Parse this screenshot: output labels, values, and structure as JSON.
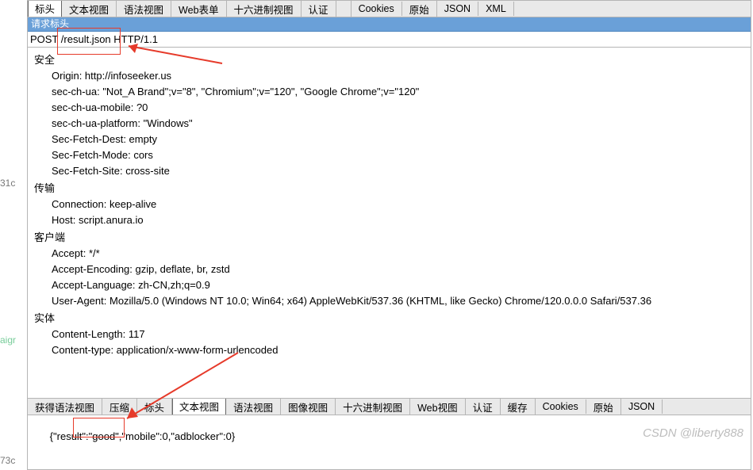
{
  "gutter": {
    "g1": "31c",
    "g2": "aigr",
    "g3": "73c"
  },
  "top_tabs": [
    {
      "id": "headers",
      "label": "标头",
      "selected": true
    },
    {
      "id": "textview",
      "label": "文本视图"
    },
    {
      "id": "syntaxview",
      "label": "语法视图"
    },
    {
      "id": "webforms",
      "label": "Web表单"
    },
    {
      "id": "hexview",
      "label": "十六进制视图"
    },
    {
      "id": "auth",
      "label": "认证"
    },
    {
      "id": "cookies",
      "label": "Cookies"
    },
    {
      "id": "raw",
      "label": "原始"
    },
    {
      "id": "json",
      "label": "JSON"
    },
    {
      "id": "xml",
      "label": "XML"
    }
  ],
  "section_bar": "请求标头",
  "request_line": {
    "method": "POST",
    "path": "/result.json",
    "version": "HTTP/1.1"
  },
  "groups": [
    {
      "title": "安全",
      "rows": [
        {
          "k": "Origin",
          "v": "http://infoseeker.us"
        },
        {
          "k": "sec-ch-ua",
          "v": "\"Not_A Brand\";v=\"8\", \"Chromium\";v=\"120\", \"Google Chrome\";v=\"120\""
        },
        {
          "k": "sec-ch-ua-mobile",
          "v": "?0"
        },
        {
          "k": "sec-ch-ua-platform",
          "v": "\"Windows\""
        },
        {
          "k": "Sec-Fetch-Dest",
          "v": "empty"
        },
        {
          "k": "Sec-Fetch-Mode",
          "v": "cors"
        },
        {
          "k": "Sec-Fetch-Site",
          "v": "cross-site"
        }
      ]
    },
    {
      "title": "传输",
      "rows": [
        {
          "k": "Connection",
          "v": "keep-alive"
        },
        {
          "k": "Host",
          "v": "script.anura.io"
        }
      ]
    },
    {
      "title": "客户端",
      "rows": [
        {
          "k": "Accept",
          "v": "*/*"
        },
        {
          "k": "Accept-Encoding",
          "v": "gzip, deflate, br, zstd"
        },
        {
          "k": "Accept-Language",
          "v": "zh-CN,zh;q=0.9"
        },
        {
          "k": "User-Agent",
          "v": "Mozilla/5.0 (Windows NT 10.0; Win64; x64) AppleWebKit/537.36 (KHTML, like Gecko) Chrome/120.0.0.0 Safari/537.36"
        }
      ]
    },
    {
      "title": "实体",
      "rows": [
        {
          "k": "Content-Length",
          "v": "117"
        },
        {
          "k": "Content-type",
          "v": "application/x-www-form-urlencoded"
        }
      ]
    }
  ],
  "bottom_tabs": [
    {
      "id": "getsyntax",
      "label": "获得语法视图"
    },
    {
      "id": "compress",
      "label": "压缩"
    },
    {
      "id": "headers2",
      "label": "标头"
    },
    {
      "id": "textview2",
      "label": "文本视图",
      "selected": true
    },
    {
      "id": "syntaxview2",
      "label": "语法视图"
    },
    {
      "id": "imageview",
      "label": "图像视图"
    },
    {
      "id": "hexview2",
      "label": "十六进制视图"
    },
    {
      "id": "webview",
      "label": "Web视图"
    },
    {
      "id": "auth2",
      "label": "认证"
    },
    {
      "id": "cache",
      "label": "缓存"
    },
    {
      "id": "cookies2",
      "label": "Cookies"
    },
    {
      "id": "raw2",
      "label": "原始"
    },
    {
      "id": "json2",
      "label": "JSON"
    }
  ],
  "response_body": "{\"result\":\"good\",\"mobile\":0,\"adblocker\":0}",
  "watermark": "CSDN @liberty888"
}
